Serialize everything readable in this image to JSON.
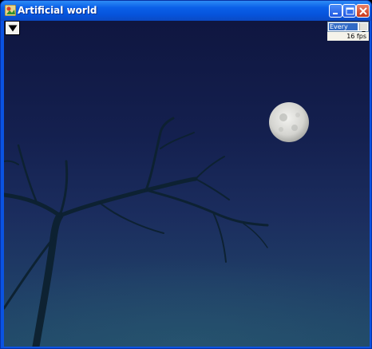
{
  "window": {
    "title": "Artificial world",
    "buttons": [
      "minimize",
      "maximize",
      "close"
    ]
  },
  "scene": {
    "menu_button_icon": "down-triangle-icon",
    "update_select": {
      "value": "Every"
    },
    "fps_readout": "16 fps"
  },
  "colors": {
    "titlebar": "#0a5fe8",
    "sky_top": "#0f1640",
    "sky_bottom": "#214a69",
    "moon": "#d9d9d6",
    "tree": "#0e2330"
  }
}
